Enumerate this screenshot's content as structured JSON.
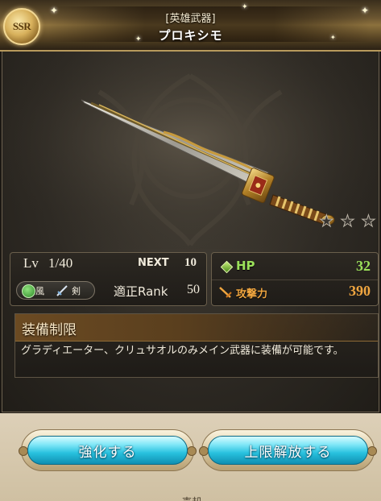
{
  "header": {
    "rarity": "SSR",
    "weapon_type": "[英雄武器]",
    "weapon_name": "プロキシモ"
  },
  "art": {
    "item": "sword",
    "stars_filled": 0,
    "stars_total": 3
  },
  "level": {
    "lv_label": "Lv",
    "lv_value": "1/40",
    "next_label": "NEXT",
    "next_value": "10",
    "element_label": "風",
    "weapon_kind_label": "剣",
    "rank_label": "適正Rank",
    "rank_value": "50"
  },
  "stats": {
    "hp_label": "HP",
    "hp_value": "32",
    "atk_label": "攻撃力",
    "atk_value": "390"
  },
  "restriction": {
    "title": "装備制限",
    "text": "グラディエーター、クリュサオルのみメイン武器に装備が可能です。"
  },
  "buttons": {
    "upgrade": "強化する",
    "uncap": "上限解放する"
  },
  "footer": {
    "partial_label": "売却"
  },
  "colors": {
    "hp": "#9be05a",
    "attack": "#f0a640",
    "button": "#28c1de",
    "header_gold": "#8c713d"
  },
  "icons": {
    "rarity": "ssr-badge-icon",
    "element": "wind-element-icon",
    "weapon_kind": "sword-type-icon",
    "hp": "hp-diamond-icon",
    "attack": "attack-sword-icon",
    "star": "star-icon"
  }
}
